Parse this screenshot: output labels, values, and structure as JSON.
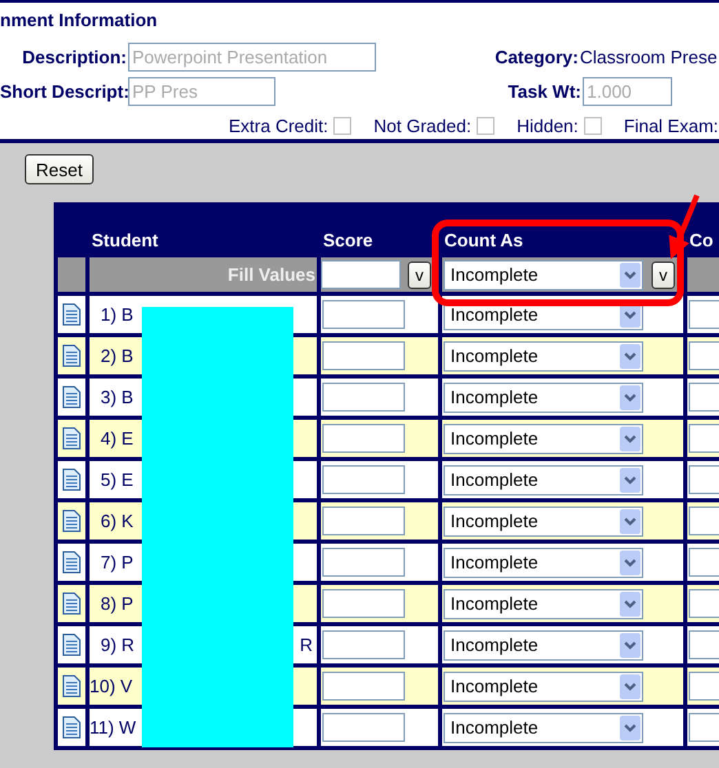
{
  "section_title": "nment Information",
  "description": {
    "label": "Description:",
    "value": "Powerpoint Presentation",
    "disabled": true
  },
  "category": {
    "label": "Category:",
    "value": "Classroom Prese"
  },
  "short_description": {
    "label": "Short Descript:",
    "value": "PP Pres",
    "disabled": true
  },
  "task_weight": {
    "label": "Task Wt:",
    "value": "1.000",
    "disabled": true
  },
  "flags": [
    {
      "label": "Extra Credit:",
      "checked": false,
      "kind": "checkbox"
    },
    {
      "label": "Not Graded:",
      "checked": false,
      "kind": "checkbox"
    },
    {
      "label": "Hidden:",
      "checked": false,
      "kind": "checkbox"
    },
    {
      "label": "Final Exam:",
      "kind": "label"
    }
  ],
  "reset_button": "Reset",
  "table": {
    "columns": [
      "Student",
      "Score",
      "Count As",
      "Co"
    ],
    "fill_row": {
      "label": "Fill Values",
      "score_button": "v",
      "count_as": "Incomplete",
      "count_button": "v"
    },
    "rows": [
      {
        "student": "1) B",
        "count_as": "Incomplete"
      },
      {
        "student": "2) B",
        "count_as": "Incomplete"
      },
      {
        "student": "3) B",
        "count_as": "Incomplete"
      },
      {
        "student": "4) E",
        "count_as": "Incomplete"
      },
      {
        "student": "5) E",
        "count_as": "Incomplete"
      },
      {
        "student": "6) K",
        "count_as": "Incomplete"
      },
      {
        "student": "7) P",
        "count_as": "Incomplete"
      },
      {
        "student": "8) P",
        "count_as": "Incomplete"
      },
      {
        "student": "9) R",
        "student_tail": "R",
        "count_as": "Incomplete"
      },
      {
        "student": "10) V",
        "count_as": "Incomplete"
      },
      {
        "student": "11) W",
        "count_as": "Incomplete"
      }
    ]
  }
}
